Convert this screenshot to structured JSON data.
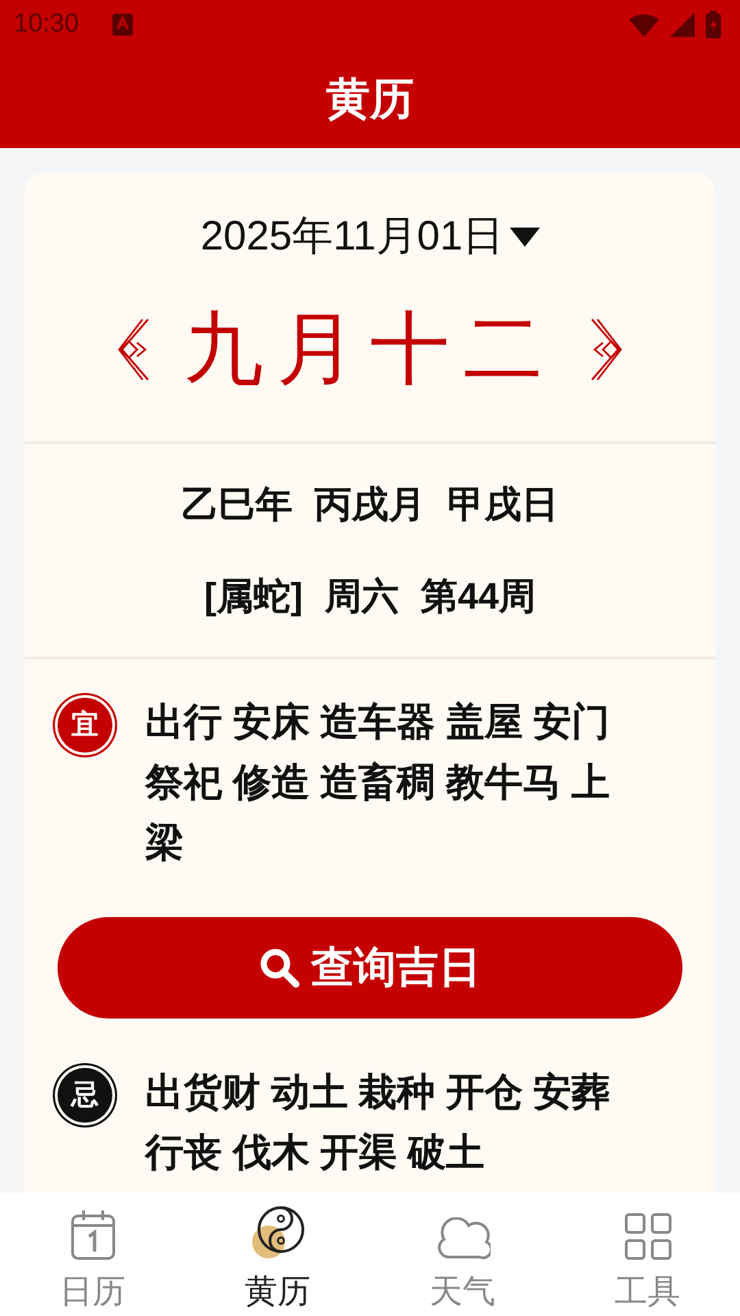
{
  "status_bar": {
    "time": "10:30"
  },
  "app_bar": {
    "title": "黄历"
  },
  "date_picker": {
    "label": "2025年11月01日"
  },
  "lunar_date": "九月十二",
  "ganzhi": [
    "乙巳年",
    "丙戌月",
    "甲戌日"
  ],
  "info": [
    "[属蛇]",
    "周六",
    "第44周"
  ],
  "yi": {
    "badge": "宜",
    "kind": "good",
    "items": [
      "出行",
      "安床",
      "造车器",
      "盖屋",
      "安门",
      "祭祀",
      "修造",
      "造畜稠",
      "教牛马",
      "上梁"
    ]
  },
  "search_button": {
    "label": "查询吉日"
  },
  "ji": {
    "badge": "忌",
    "kind": "bad",
    "items": [
      "出货财",
      "动土",
      "栽种",
      "开仓",
      "安葬",
      "行丧",
      "伐木",
      "开渠",
      "破土"
    ]
  },
  "bottom_nav": [
    {
      "label": "日历",
      "selected": false
    },
    {
      "label": "黄历",
      "selected": true
    },
    {
      "label": "天气",
      "selected": false
    },
    {
      "label": "工具",
      "selected": false
    }
  ]
}
